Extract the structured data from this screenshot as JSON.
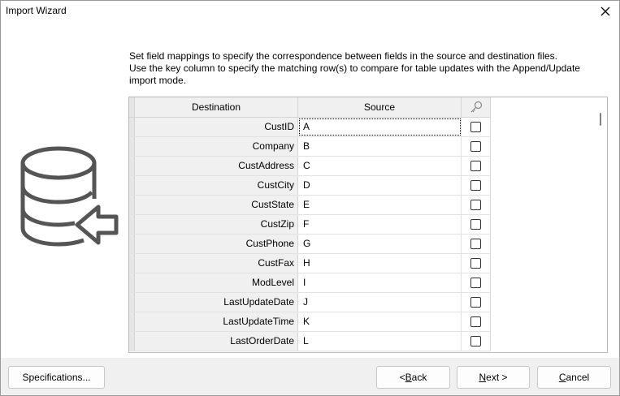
{
  "window": {
    "title": "Import Wizard"
  },
  "instructions": {
    "line1": "Set field mappings to specify the correspondence between fields in the source and destination files.",
    "line2": "Use the key column to specify the matching row(s) to compare for table updates with the Append/Update",
    "line3": "import mode."
  },
  "grid": {
    "headers": {
      "destination": "Destination",
      "source": "Source"
    },
    "key_icon": "key-icon",
    "rows": [
      {
        "destination": "CustID",
        "source": "A",
        "key": false
      },
      {
        "destination": "Company",
        "source": "B",
        "key": false
      },
      {
        "destination": "CustAddress",
        "source": "C",
        "key": false
      },
      {
        "destination": "CustCity",
        "source": "D",
        "key": false
      },
      {
        "destination": "CustState",
        "source": "E",
        "key": false
      },
      {
        "destination": "CustZip",
        "source": "F",
        "key": false
      },
      {
        "destination": "CustPhone",
        "source": "G",
        "key": false
      },
      {
        "destination": "CustFax",
        "source": "H",
        "key": false
      },
      {
        "destination": "ModLevel",
        "source": "I",
        "key": false
      },
      {
        "destination": "LastUpdateDate",
        "source": "J",
        "key": false
      },
      {
        "destination": "LastUpdateTime",
        "source": "K",
        "key": false
      },
      {
        "destination": "LastOrderDate",
        "source": "L",
        "key": false
      }
    ]
  },
  "buttons": {
    "specifications": "Specifications...",
    "back_prefix": "< ",
    "back_mnemonic": "B",
    "back_rest": "ack",
    "next_mnemonic": "N",
    "next_rest": "ext >",
    "cancel_mnemonic": "C",
    "cancel_rest": "ancel"
  },
  "colors": {
    "footer_bg": "#f0f0f0",
    "header_bg": "#f0f0f0",
    "icon_stroke": "#555555"
  }
}
